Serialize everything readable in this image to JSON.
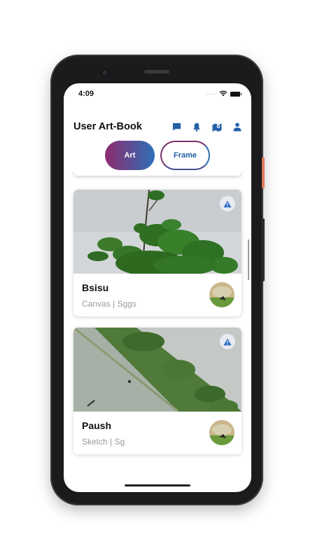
{
  "status_bar": {
    "time": "4:09"
  },
  "header": {
    "title": "User Art-Book",
    "icons": [
      "chat-icon",
      "bell-icon",
      "map-icon",
      "person-icon"
    ]
  },
  "tabs": {
    "active": "Art",
    "inactive": "Frame"
  },
  "cards": [
    {
      "title": "Bsisu",
      "subtitle": "Canvas | Sggs",
      "badge_icon": "warning-icon"
    },
    {
      "title": "Paush",
      "subtitle": "Sketch | Sg",
      "badge_icon": "warning-icon"
    }
  ],
  "colors": {
    "accent_blue": "#2460a8",
    "gradient_start": "#8e2a6e",
    "gradient_end": "#2e6fb8"
  }
}
